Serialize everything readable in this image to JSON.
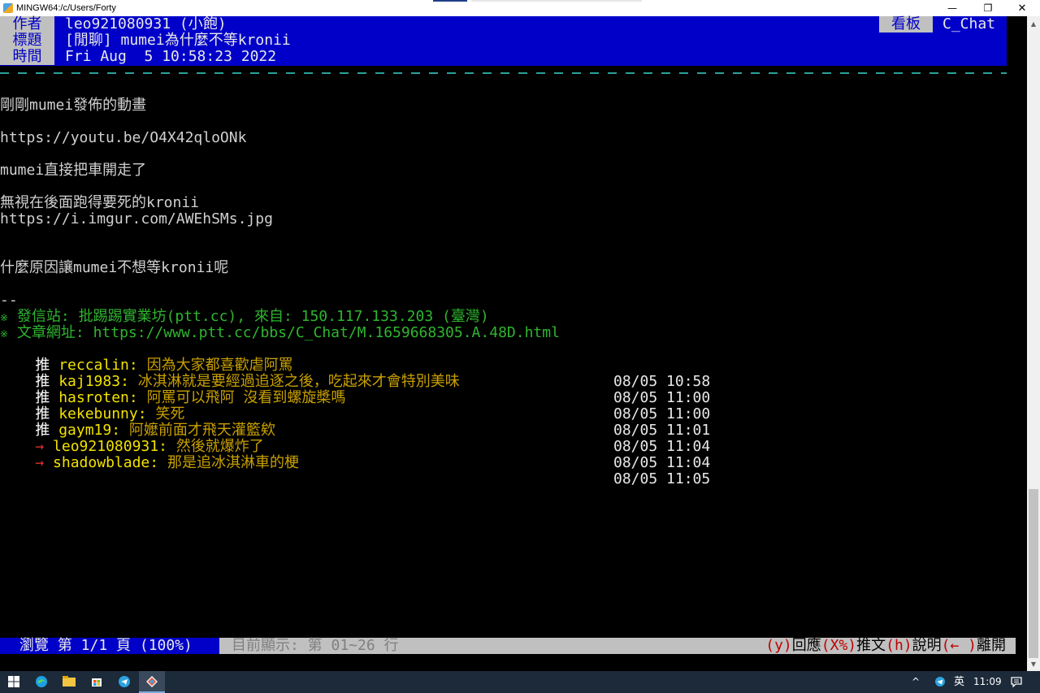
{
  "window": {
    "title": "MINGW64:/c/Users/Forty",
    "min_glyph": "—",
    "max_glyph": "❐",
    "close_glyph": "✕"
  },
  "header": {
    "author_label": "作者",
    "author_value": "leo921080931 (小飽)",
    "title_label": "標題",
    "title_value": "[閒聊] mumei為什麼不等kronii",
    "time_label": "時間",
    "time_value": "Fri Aug  5 10:58:23 2022",
    "board_label": "看板",
    "board_value": "C_Chat"
  },
  "body": {
    "line1": "剛剛mumei發佈的動畫",
    "line2": "https://youtu.be/O4X42qloONk",
    "line3": "mumei直接把車開走了",
    "line4": "無視在後面跑得要死的kronii",
    "line5": "https://i.imgur.com/AWEhSMs.jpg",
    "line6": "什麼原因讓mumei不想等kronii呢",
    "sig_sep": "--"
  },
  "signature": {
    "mark": "※",
    "site_line": " 發信站: 批踢踢實業坊(ptt.cc), 來自: 150.117.133.203 (臺灣)",
    "url_line": " 文章網址: https://www.ptt.cc/bbs/C_Chat/M.1659668305.A.48D.html"
  },
  "pushes": [
    {
      "tag": "推",
      "user": "reccalin",
      "content": "因為大家都喜歡虐阿罵",
      "time": "08/05 10:58"
    },
    {
      "tag": "推",
      "user": "kaj1983",
      "content": "冰淇淋就是要經過追逐之後，吃起來才會特別美味",
      "time": "08/05 11:00"
    },
    {
      "tag": "推",
      "user": "hasroten",
      "content": "阿罵可以飛阿 沒看到螺旋槳嗎",
      "time": "08/05 11:00"
    },
    {
      "tag": "推",
      "user": "kekebunny",
      "content": "笑死",
      "time": "08/05 11:01"
    },
    {
      "tag": "推",
      "user": "gaym19",
      "content": "阿嬤前面才飛天灌籃欸",
      "time": "08/05 11:04"
    },
    {
      "tag": "→",
      "user": "leo921080931",
      "content": "然後就爆炸了",
      "time": "08/05 11:04"
    },
    {
      "tag": "→",
      "user": "shadowblade",
      "content": "那是追冰淇淋車的梗",
      "time": "08/05 11:05"
    }
  ],
  "footer": {
    "browse": "瀏覽 第 1/1 頁 (100%)",
    "showing": "目前顯示: 第 01~26 行",
    "key_reply": "(y)",
    "act_reply": "回應",
    "key_push": "(X%)",
    "act_push": "推文",
    "key_help": "(h)",
    "act_help": "說明",
    "key_leave": "(← )",
    "act_leave": "離開"
  },
  "taskbar": {
    "tray_chevron": "^",
    "ime": "英",
    "clock": "11:09"
  },
  "colors": {
    "header_bg": "#0000c8",
    "label_bg": "#c0c0c0",
    "signature": "#2fb52f",
    "push_user": "#f2e200",
    "push_content": "#c8a000",
    "arrow": "#e03030"
  }
}
